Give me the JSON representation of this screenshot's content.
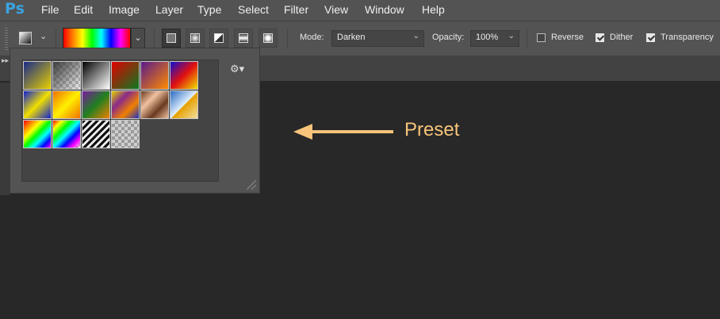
{
  "app": {
    "logo": "Ps"
  },
  "menu": [
    "File",
    "Edit",
    "Image",
    "Layer",
    "Type",
    "Select",
    "Filter",
    "View",
    "Window",
    "Help"
  ],
  "options": {
    "mode_label": "Mode:",
    "mode_value": "Darken",
    "opacity_label": "Opacity:",
    "opacity_value": "100%",
    "reverse_label": "Reverse",
    "reverse_checked": false,
    "dither_label": "Dither",
    "dither_checked": true,
    "transparency_label": "Transparency",
    "transparency_checked": true,
    "gradient_types": [
      "linear",
      "radial",
      "angle",
      "reflected",
      "diamond"
    ],
    "active_gradient_type": "linear"
  },
  "gradient_picker": {
    "presets": [
      "blue-yellow",
      "checker-transparent",
      "black-white",
      "red-green",
      "violet-orange",
      "blue-red-yellow",
      "blue-yellow-blue",
      "orange-yellow-orange",
      "violet-green-orange",
      "yellow-violet-orange-blue",
      "copper",
      "chrome",
      "spectrum",
      "transparent-rainbow",
      "transparent-stripes",
      "checker-transparent-2"
    ]
  },
  "annotation": {
    "text": "Preset",
    "color": "#f6c47a"
  },
  "colors": {
    "menubar": "#535353",
    "canvas": "#282828",
    "accent": "#3aa3e0"
  }
}
